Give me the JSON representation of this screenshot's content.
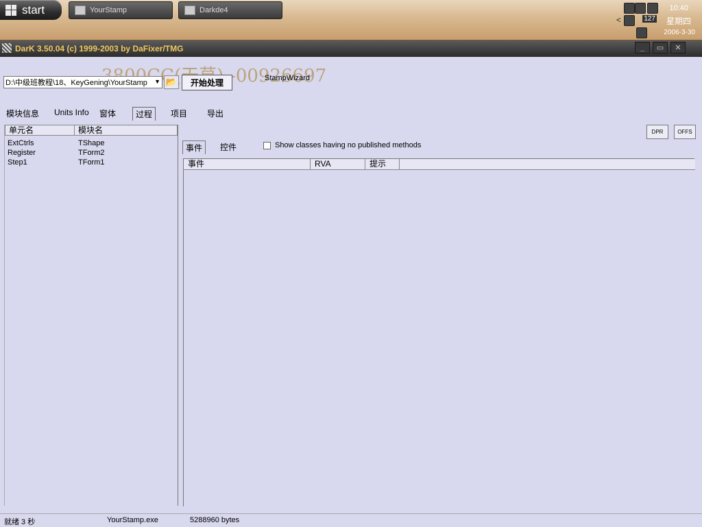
{
  "taskbar": {
    "start_label": "start",
    "tasks": [
      {
        "label": "YourStamp",
        "icon": "window-icon"
      },
      {
        "label": "Darkde4",
        "icon": "app-icon"
      }
    ],
    "clock": {
      "time": "10:40",
      "weekday": "星期四",
      "date": "2006-3-30"
    },
    "tray_badge": "127"
  },
  "window": {
    "title": "DarK 3.50.04 (c) 1999-2003 by DaFixer/TMG",
    "controls": [
      "minimize-icon",
      "maximize-icon",
      "close-icon"
    ]
  },
  "watermark": "3800CC(天草)--00926697",
  "toolbar": {
    "path_value": "D:\\中级班教程\\18、KeyGening\\YourStamp",
    "process_label": "开始处理",
    "wizard_label": "StampWizard"
  },
  "main_tabs": [
    "模块信息",
    "Units Info",
    "窗体",
    "过程",
    "项目",
    "导出"
  ],
  "left_list": {
    "headers": [
      "单元名",
      "模块名"
    ],
    "rows": [
      [
        "ExtCtrls",
        "TShape"
      ],
      [
        "Register",
        "TForm2"
      ],
      [
        "Step1",
        "TForm1"
      ]
    ]
  },
  "right": {
    "dpr_label": "DPR",
    "offs_label": "OFFS",
    "sub_tabs": [
      "事件",
      "控件"
    ],
    "checkbox_label": "Show classes having no published methods",
    "checkbox_checked": false,
    "grid_headers": [
      "事件",
      "RVA",
      "提示"
    ]
  },
  "status": {
    "state": "就绪 3 秒",
    "file": "YourStamp.exe",
    "size": "5288960 bytes"
  },
  "colors": {
    "background": "#d8d8ee",
    "titlebar": "#2c2c2c",
    "title_text": "#f0c860",
    "watermark": "#b89a6a"
  }
}
